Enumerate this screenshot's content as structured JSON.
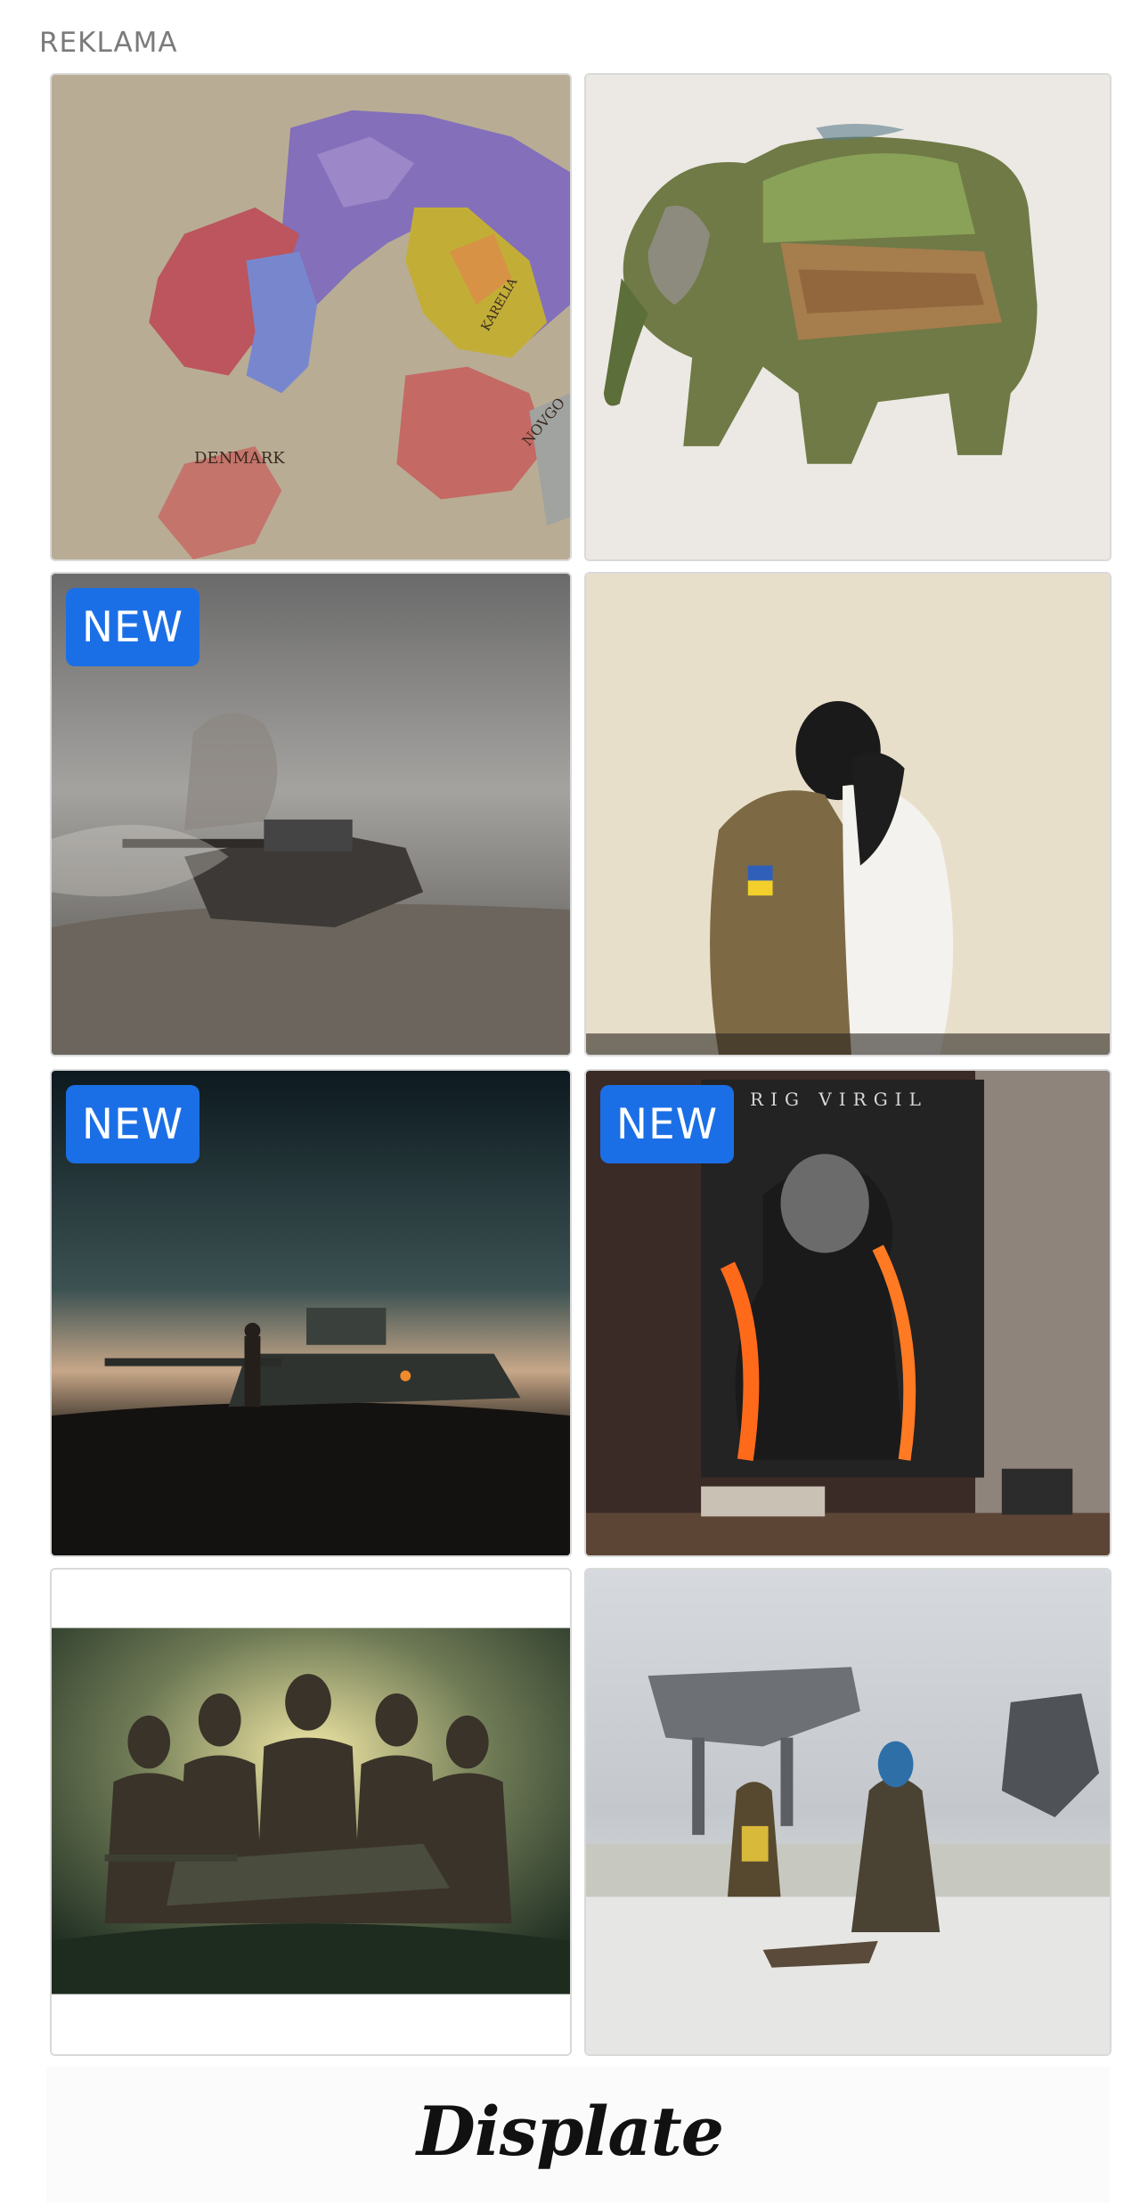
{
  "ad_label": "REKLAMA",
  "adchoices": {
    "info_icon": "adchoices-triangle-icon",
    "close_icon": "close-x-icon",
    "accent": "#1aa3d9"
  },
  "tiles": [
    {
      "art": "map of scandinavia",
      "badge": ""
    },
    {
      "art": "landscape elephant",
      "badge": ""
    },
    {
      "art": "tank in storm",
      "badge": "NEW"
    },
    {
      "art": "soldier embrace",
      "badge": ""
    },
    {
      "art": "tank at dusk",
      "badge": "NEW"
    },
    {
      "art": "burning player poster",
      "badge": "NEW"
    },
    {
      "art": "band with tank",
      "badge": ""
    },
    {
      "art": "winter mechs",
      "badge": ""
    }
  ],
  "map_labels": {
    "denmark": "DENMARK",
    "karelia": "KARELIA",
    "novgorod": "NOVGO"
  },
  "poster_caption": "RIG VIRGIL",
  "brand": {
    "name": "Displate",
    "badge_color": "#1b6fe6"
  }
}
